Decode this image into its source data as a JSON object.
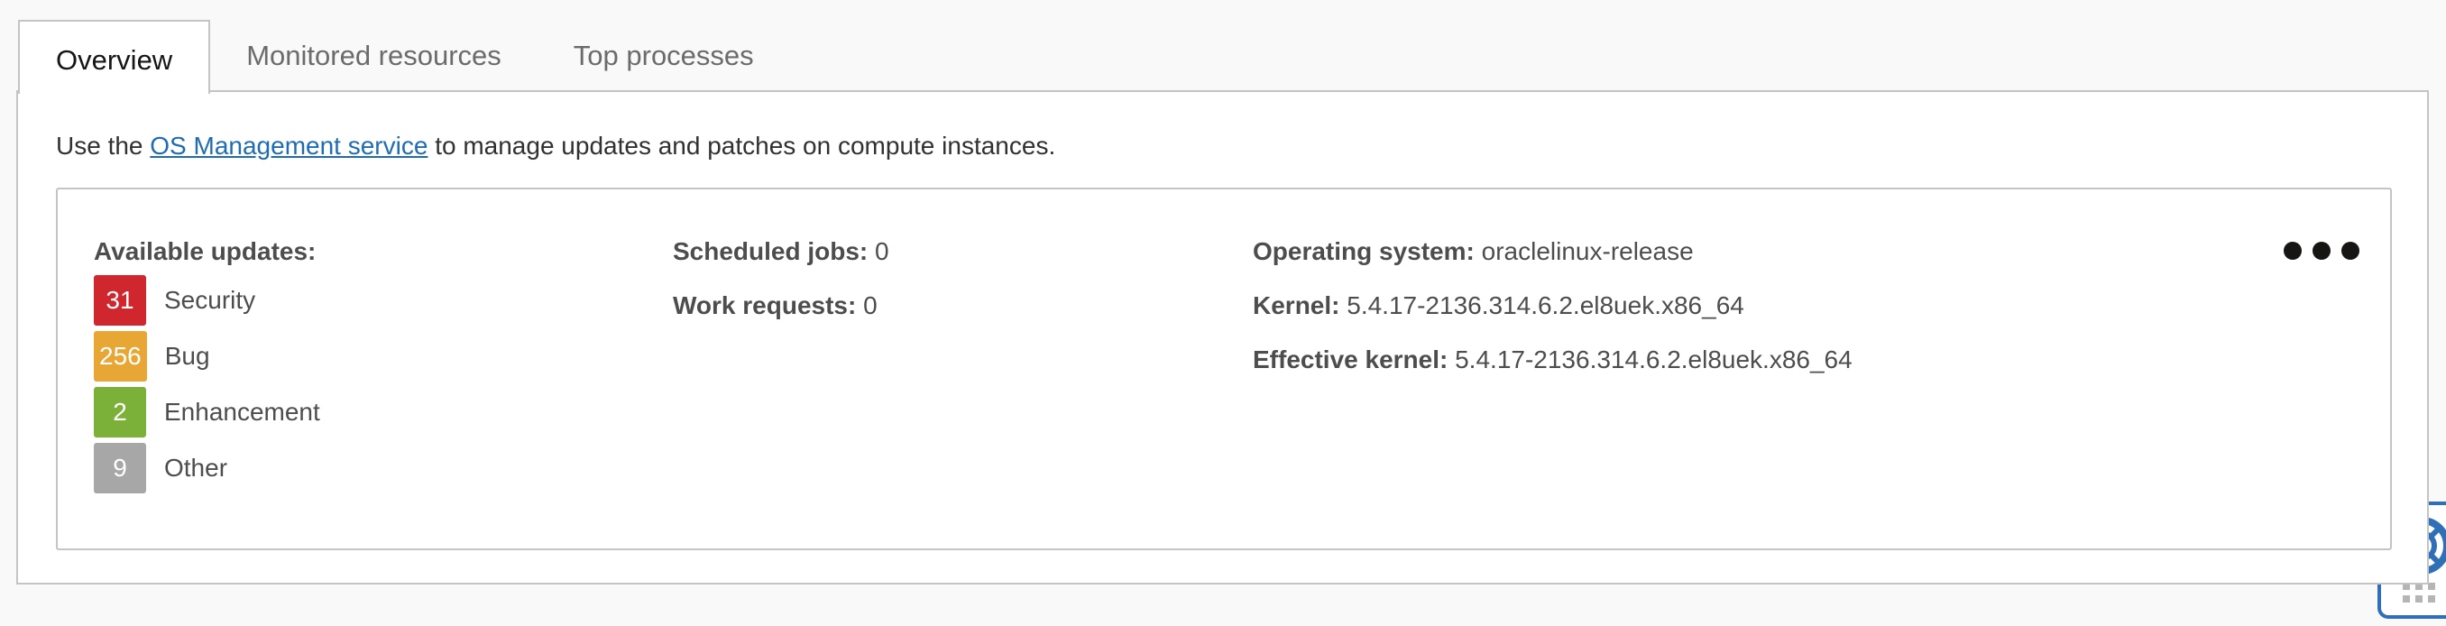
{
  "tabs": [
    {
      "label": "Overview",
      "active": true
    },
    {
      "label": "Monitored resources",
      "active": false
    },
    {
      "label": "Top processes",
      "active": false
    }
  ],
  "intro": {
    "prefix": "Use the ",
    "link": "OS Management service",
    "suffix": " to manage updates and patches on compute instances."
  },
  "updates": {
    "title": "Available updates:",
    "items": [
      {
        "count": "31",
        "label": "Security",
        "color": "#d0262d"
      },
      {
        "count": "256",
        "label": "Bug",
        "color": "#e8a735"
      },
      {
        "count": "2",
        "label": "Enhancement",
        "color": "#7cb139"
      },
      {
        "count": "9",
        "label": "Other",
        "color": "#a7a7a7"
      }
    ]
  },
  "jobs": {
    "scheduled_label": "Scheduled jobs:",
    "scheduled_value": "0",
    "work_label": "Work requests:",
    "work_value": "0"
  },
  "system": {
    "os_label": "Operating system:",
    "os_value": "oraclelinux-release",
    "kernel_label": "Kernel:",
    "kernel_value": "5.4.17-2136.314.6.2.el8uek.x86_64",
    "effective_label": "Effective kernel:",
    "effective_value": "5.4.17-2136.314.6.2.el8uek.x86_64"
  },
  "icons": {
    "more": "more-actions-icon",
    "help": "lifebuoy-help-icon",
    "grip": "drag-grip-icon"
  }
}
